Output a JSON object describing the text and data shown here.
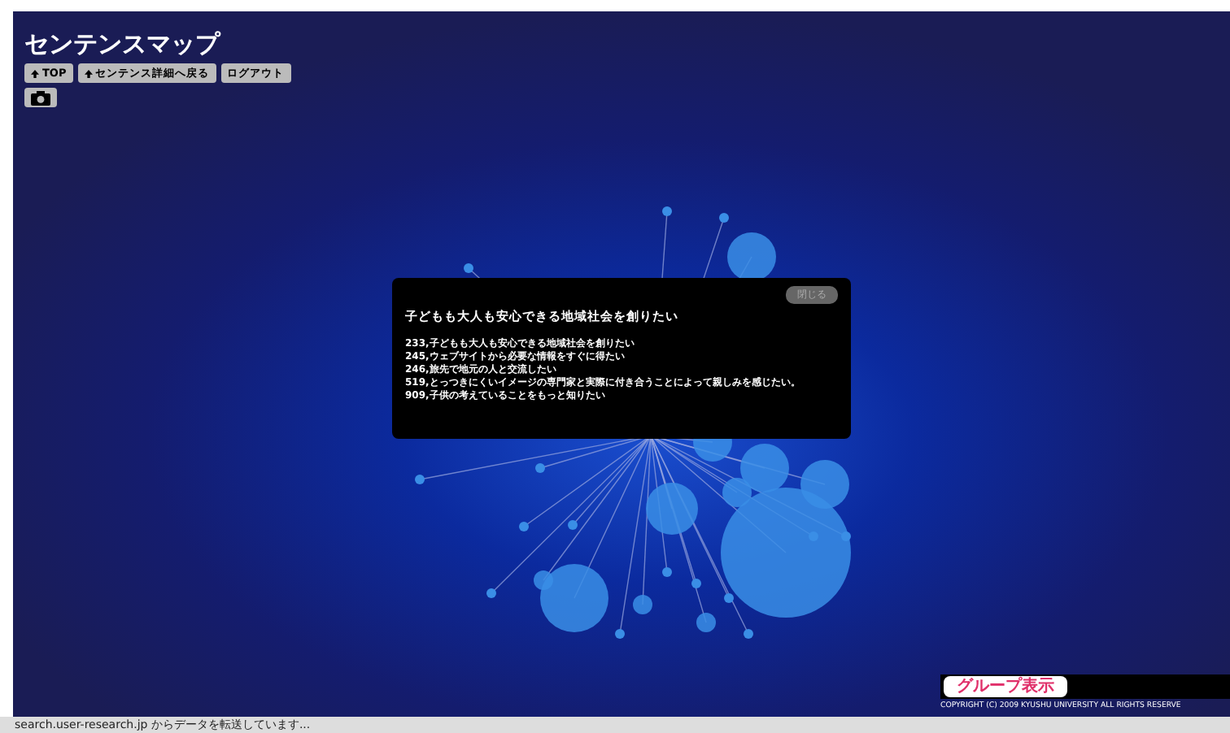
{
  "title": "センテンスマップ",
  "nav_buttons": [
    {
      "kind": "arrow",
      "label": "TOP"
    },
    {
      "kind": "arrow",
      "label": "センテンス詳細へ戻る"
    },
    {
      "kind": "plain",
      "label": "ログアウト"
    }
  ],
  "dialog": {
    "close": "閉じる",
    "heading": "子どもも大人も安心できる地域社会を創りたい",
    "lines": [
      "233,子どもも大人も安心できる地域社会を創りたい",
      "245,ウェブサイトから必要な情報をすぐに得たい",
      "246,旅先で地元の人と交流したい",
      "519,とっつきにくいイメージの専門家と実際に付き合うことによって親しみを感じたい。",
      "909,子供の考えていることをもっと知りたい"
    ]
  },
  "group_button": "グループ表示",
  "copyright": "COPYRIGHT (C) 2009 KYUSHU UNIVERSITY ALL RIGHTS RESERVE",
  "status_bar": "search.user-research.jp からデータを転送しています..."
}
